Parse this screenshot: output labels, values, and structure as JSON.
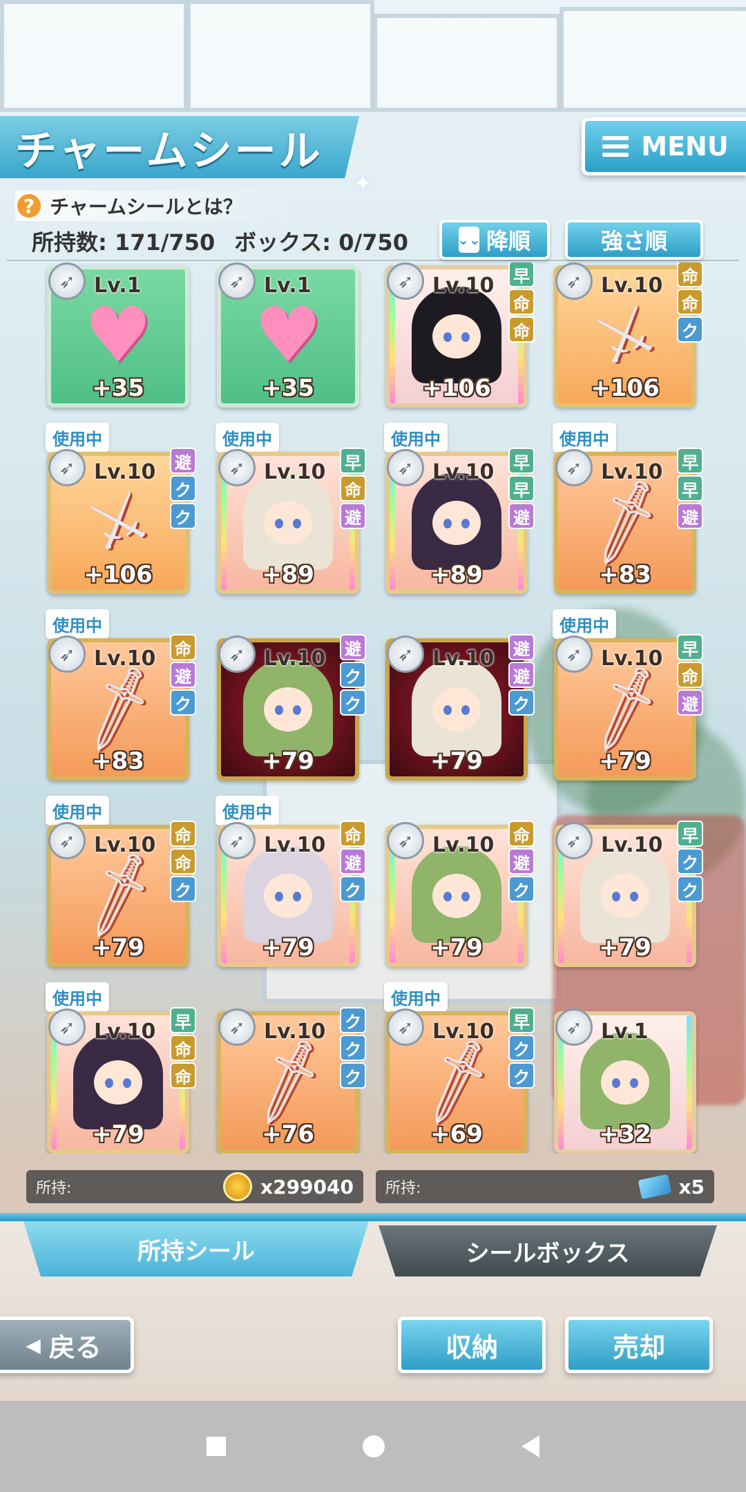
{
  "header": {
    "title": "チャームシール",
    "menu_label": "MENU",
    "help_text": "チャームシールとは？",
    "owned_count": "所持数: 171/750",
    "box_count": "ボックス: 0/750",
    "sort_order_label": "降順",
    "sort_key_label": "強さ順"
  },
  "cards": [
    {
      "inuse": "",
      "lv": "Lv.1",
      "plus": "+35",
      "art": "heart",
      "style": "green",
      "tags": []
    },
    {
      "inuse": "",
      "lv": "Lv.1",
      "plus": "+35",
      "art": "heart",
      "style": "green",
      "tags": []
    },
    {
      "inuse": "",
      "lv": "Lv.10",
      "plus": "+106",
      "art": "char",
      "style": "pastel",
      "tags": [
        "早",
        "命",
        "命"
      ]
    },
    {
      "inuse": "",
      "lv": "Lv.10",
      "plus": "+106",
      "art": "swords",
      "style": "gold",
      "tags": [
        "命",
        "命",
        "ク"
      ]
    },
    {
      "inuse": "使用中",
      "lv": "Lv.10",
      "plus": "+106",
      "art": "swords",
      "style": "gold",
      "tags": [
        "避",
        "ク",
        "ク"
      ]
    },
    {
      "inuse": "使用中",
      "lv": "Lv.10",
      "plus": "+89",
      "art": "char",
      "style": "pink",
      "tags": [
        "早",
        "命",
        "避"
      ]
    },
    {
      "inuse": "使用中",
      "lv": "Lv.10",
      "plus": "+89",
      "art": "char",
      "style": "pink",
      "tags": [
        "早",
        "早",
        "避"
      ]
    },
    {
      "inuse": "使用中",
      "lv": "Lv.10",
      "plus": "+83",
      "art": "sword",
      "style": "orange",
      "tags": [
        "早",
        "早",
        "避"
      ]
    },
    {
      "inuse": "使用中",
      "lv": "Lv.10",
      "plus": "+83",
      "art": "sword",
      "style": "orange",
      "tags": [
        "命",
        "避",
        "ク"
      ]
    },
    {
      "inuse": "",
      "lv": "Lv.10",
      "plus": "+79",
      "art": "char",
      "style": "dark",
      "tags": [
        "避",
        "ク",
        "ク"
      ]
    },
    {
      "inuse": "",
      "lv": "Lv.10",
      "plus": "+79",
      "art": "char",
      "style": "dark",
      "tags": [
        "避",
        "避",
        "ク"
      ]
    },
    {
      "inuse": "使用中",
      "lv": "Lv.10",
      "plus": "+79",
      "art": "sword",
      "style": "orange",
      "tags": [
        "早",
        "命",
        "避"
      ]
    },
    {
      "inuse": "使用中",
      "lv": "Lv.10",
      "plus": "+79",
      "art": "sword",
      "style": "orange",
      "tags": [
        "命",
        "命",
        "ク"
      ]
    },
    {
      "inuse": "使用中",
      "lv": "Lv.10",
      "plus": "+79",
      "art": "char",
      "style": "pink",
      "tags": [
        "命",
        "避",
        "ク"
      ]
    },
    {
      "inuse": "",
      "lv": "Lv.10",
      "plus": "+79",
      "art": "char",
      "style": "pink",
      "tags": [
        "命",
        "避",
        "ク"
      ]
    },
    {
      "inuse": "",
      "lv": "Lv.10",
      "plus": "+79",
      "art": "char",
      "style": "pink",
      "tags": [
        "早",
        "ク",
        "ク"
      ]
    },
    {
      "inuse": "使用中",
      "lv": "Lv.10",
      "plus": "+79",
      "art": "char",
      "style": "pink",
      "tags": [
        "早",
        "命",
        "命"
      ]
    },
    {
      "inuse": "",
      "lv": "Lv.10",
      "plus": "+76",
      "art": "sword",
      "style": "orange",
      "tags": [
        "ク",
        "ク",
        "ク"
      ]
    },
    {
      "inuse": "使用中",
      "lv": "Lv.10",
      "plus": "+69",
      "art": "sword",
      "style": "orange",
      "tags": [
        "早",
        "ク",
        "ク"
      ]
    },
    {
      "inuse": "",
      "lv": "Lv.1",
      "plus": "+32",
      "art": "char",
      "style": "pastel",
      "tags": []
    }
  ],
  "currency": {
    "gold_label": "所持:",
    "gold_value": "x299040",
    "ticket_label": "所持:",
    "ticket_value": "x5"
  },
  "tabs": {
    "owned": "所持シール",
    "box": "シールボックス"
  },
  "buttons": {
    "back": "戻る",
    "store": "収納",
    "sell": "売却"
  }
}
